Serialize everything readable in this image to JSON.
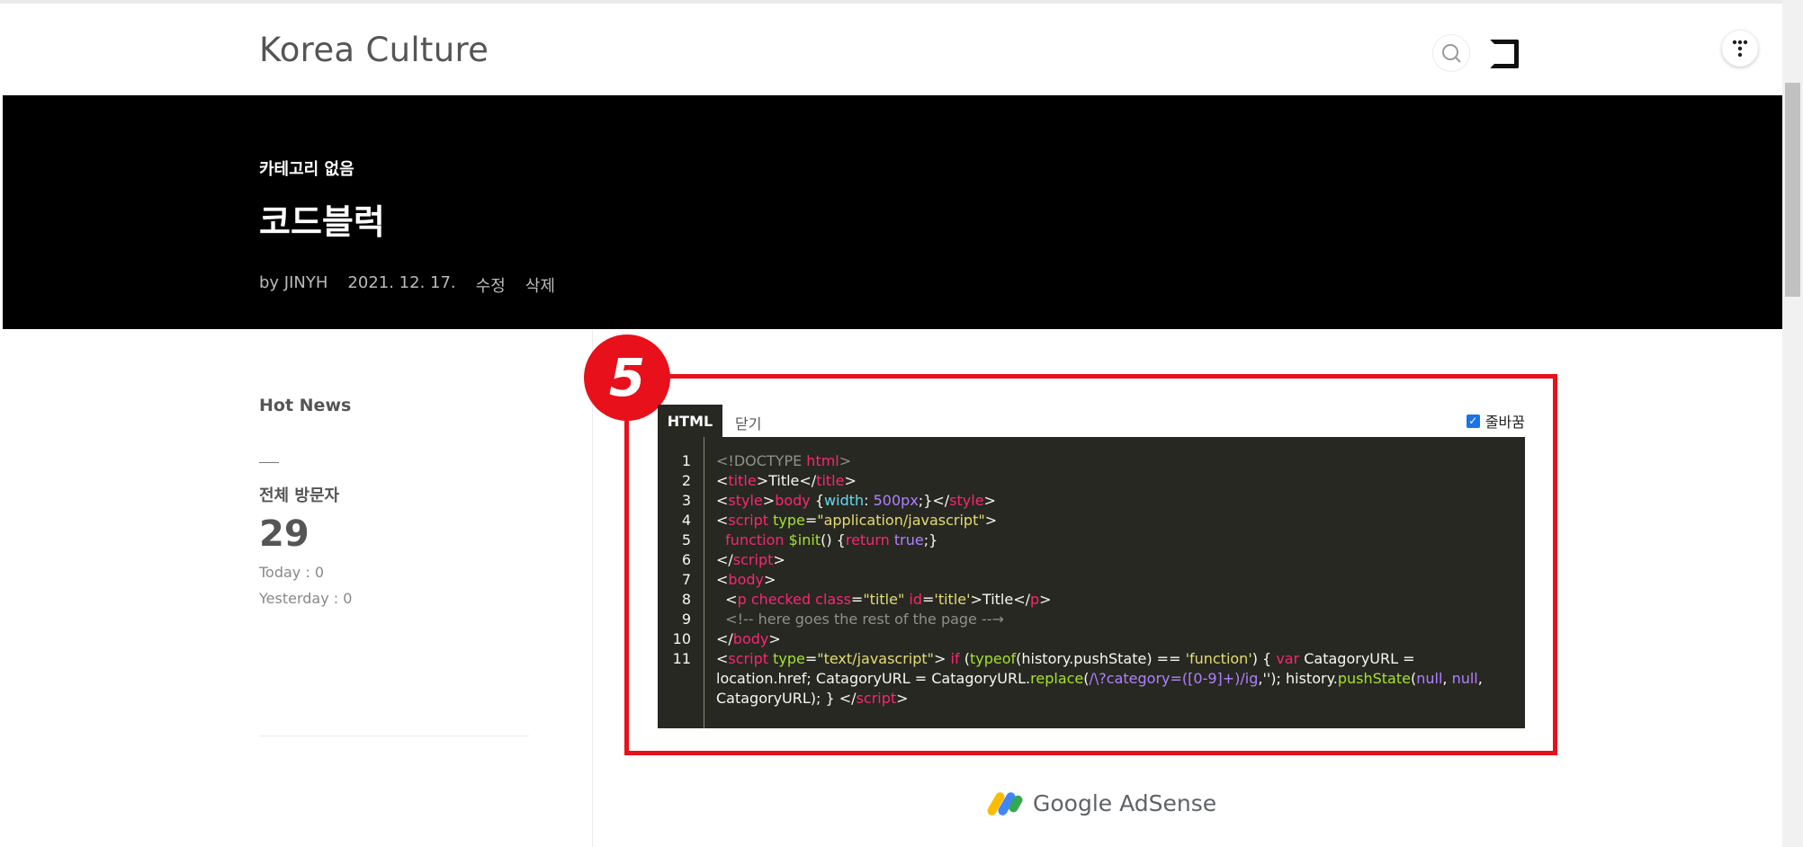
{
  "header": {
    "site_title": "Korea Culture",
    "search_icon": "search-icon",
    "menu_icon": "menu-icon",
    "tistory_icon": "tistory-icon"
  },
  "post": {
    "category": "카테고리 없음",
    "title": "코드블럭",
    "author": "by JINYH",
    "date": "2021. 12. 17.",
    "edit_label": "수정",
    "delete_label": "삭제"
  },
  "sidebar": {
    "hot_news": "Hot News",
    "visitors_label": "전체 방문자",
    "visitors_count": "29",
    "today": "Today : 0",
    "yesterday": "Yesterday : 0"
  },
  "annotation": {
    "badge_number": "5",
    "highlight_color": "#e8101a"
  },
  "code_block": {
    "active_tab": "HTML",
    "close_label": "닫기",
    "wrap_label": "줄바꿈",
    "wrap_checked": true,
    "line_numbers": [
      "1",
      "2",
      "3",
      "4",
      "5",
      "6",
      "7",
      "8",
      "9",
      "10",
      "11"
    ],
    "lines": [
      [
        [
          "t-gray",
          "<!DOCTYPE "
        ],
        [
          "t-pink",
          "html"
        ],
        [
          "t-gray",
          ">"
        ]
      ],
      [
        [
          "t-white",
          "<"
        ],
        [
          "t-pink",
          "title"
        ],
        [
          "t-white",
          ">Title</"
        ],
        [
          "t-pink",
          "title"
        ],
        [
          "t-white",
          ">"
        ]
      ],
      [
        [
          "t-white",
          "<"
        ],
        [
          "t-pink",
          "style"
        ],
        [
          "t-white",
          ">"
        ],
        [
          "t-pink",
          "body "
        ],
        [
          "t-white",
          "{"
        ],
        [
          "t-cyan",
          "width"
        ],
        [
          "t-white",
          ": "
        ],
        [
          "t-purple",
          "500px"
        ],
        [
          "t-white",
          ";}</"
        ],
        [
          "t-pink",
          "style"
        ],
        [
          "t-white",
          ">"
        ]
      ],
      [
        [
          "t-white",
          "<"
        ],
        [
          "t-pink",
          "script "
        ],
        [
          "t-green",
          "type"
        ],
        [
          "t-white",
          "="
        ],
        [
          "t-yellow",
          "\"application/javascript\""
        ],
        [
          "t-white",
          ">"
        ]
      ],
      [
        [
          "t-white",
          "  "
        ],
        [
          "t-pink",
          "function "
        ],
        [
          "t-green",
          "$init"
        ],
        [
          "t-white",
          "() {"
        ],
        [
          "t-pink",
          "return "
        ],
        [
          "t-purple",
          "true"
        ],
        [
          "t-white",
          ";}"
        ]
      ],
      [
        [
          "t-white",
          "</"
        ],
        [
          "t-pink",
          "script"
        ],
        [
          "t-white",
          ">"
        ]
      ],
      [
        [
          "t-white",
          "<"
        ],
        [
          "t-pink",
          "body"
        ],
        [
          "t-white",
          ">"
        ]
      ],
      [
        [
          "t-white",
          "  <"
        ],
        [
          "t-pink",
          "p checked class"
        ],
        [
          "t-white",
          "="
        ],
        [
          "t-yellow",
          "\"title\" "
        ],
        [
          "t-pink",
          "id"
        ],
        [
          "t-white",
          "="
        ],
        [
          "t-yellow",
          "'title'"
        ],
        [
          "t-white",
          ">Title</"
        ],
        [
          "t-pink",
          "p"
        ],
        [
          "t-white",
          ">"
        ]
      ],
      [
        [
          "t-gray",
          "  <!-- here goes the rest of the page --→"
        ]
      ],
      [
        [
          "t-white",
          "</"
        ],
        [
          "t-pink",
          "body"
        ],
        [
          "t-white",
          ">"
        ]
      ],
      [
        [
          "t-white",
          "<"
        ],
        [
          "t-pink",
          "script "
        ],
        [
          "t-green",
          "type"
        ],
        [
          "t-white",
          "="
        ],
        [
          "t-yellow",
          "\"text/javascript\""
        ],
        [
          "t-white",
          "> "
        ],
        [
          "t-pink",
          "if "
        ],
        [
          "t-white",
          "("
        ],
        [
          "t-green",
          "typeof"
        ],
        [
          "t-white",
          "(history.pushState) == "
        ],
        [
          "t-yellow",
          "'function'"
        ],
        [
          "t-white",
          ") { "
        ],
        [
          "t-pink",
          "var "
        ],
        [
          "t-white",
          "CatagoryURL ="
        ]
      ],
      [
        [
          "t-white",
          "location.href; CatagoryURL = CatagoryURL."
        ],
        [
          "t-green",
          "replace"
        ],
        [
          "t-white",
          "("
        ],
        [
          "t-purple",
          "/\\?category=([0-9]+)/ig"
        ],
        [
          "t-white",
          ",''); history."
        ],
        [
          "t-green",
          "pushState"
        ],
        [
          "t-white",
          "("
        ],
        [
          "t-purple",
          "null"
        ],
        [
          "t-white",
          ", "
        ],
        [
          "t-purple",
          "null"
        ],
        [
          "t-white",
          ","
        ]
      ],
      [
        [
          "t-white",
          "CatagoryURL); } </"
        ],
        [
          "t-pink",
          "script"
        ],
        [
          "t-white",
          ">"
        ]
      ]
    ]
  },
  "adsense": {
    "label": "Google AdSense"
  }
}
